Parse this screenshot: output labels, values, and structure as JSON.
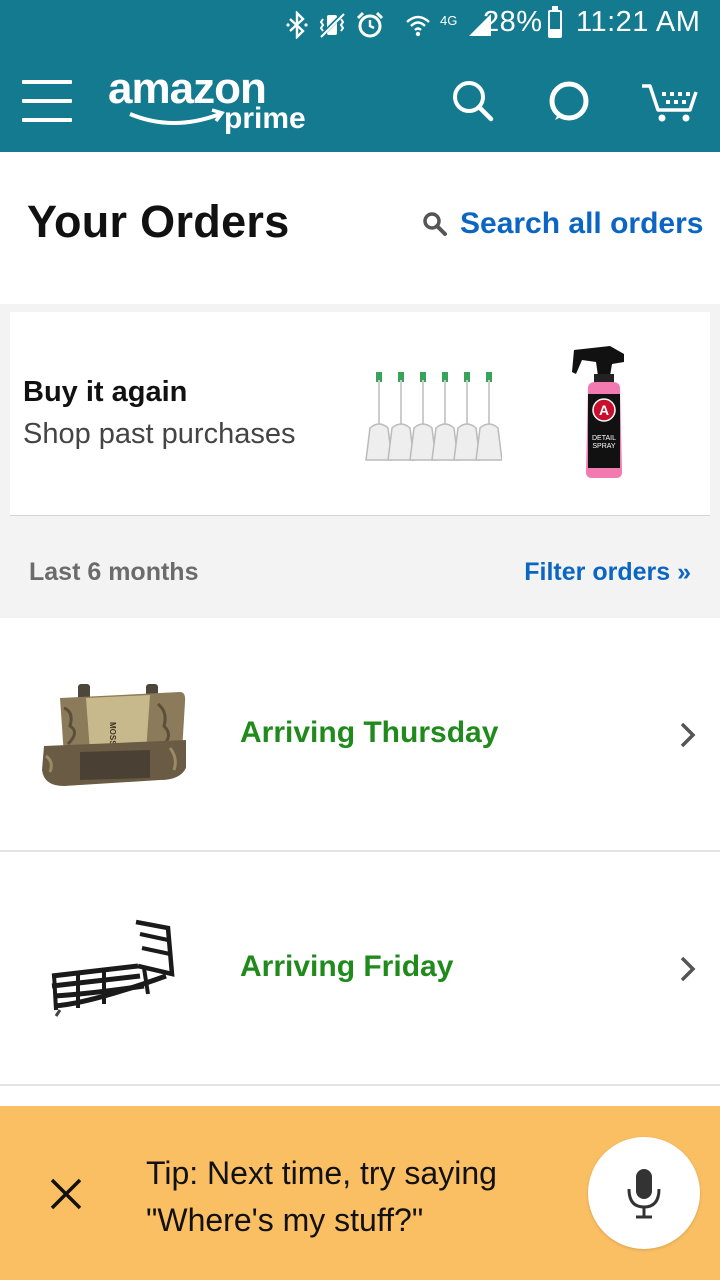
{
  "status_bar": {
    "battery_percent": "28%",
    "battery_level": 0.28,
    "time": "11:21 AM",
    "network": "4G",
    "icons": [
      "bluetooth-icon",
      "vibrate-icon",
      "alarm-icon",
      "wifi-icon",
      "signal-icon"
    ]
  },
  "app_bar": {
    "logo_word": "amazon",
    "logo_sub": "prime",
    "background": "#137a8f",
    "actions": [
      "search-icon",
      "alexa-icon",
      "cart-icon"
    ]
  },
  "orders": {
    "title": "Your Orders",
    "search_label": "Search all orders"
  },
  "buy_again": {
    "title": "Buy it again",
    "subtitle": "Shop past purchases",
    "product_icons": [
      "toothbrush-heads-image",
      "detail-spray-image"
    ],
    "spray_label_line1": "DETAIL",
    "spray_label_line2": "SPRAY",
    "spray_logo_letter": "A"
  },
  "filter": {
    "period": "Last 6 months",
    "link": "Filter orders »"
  },
  "order_list": [
    {
      "status": "Arriving Thursday",
      "image": "camo-seat-cover-image",
      "brand": "MOSSY OAK"
    },
    {
      "status": "Arriving Friday",
      "image": "truck-bed-extender-image"
    }
  ],
  "tip": {
    "line1": "Tip: Next time, try saying",
    "line2": "\"Where's my stuff?\"",
    "background": "#fbbf63"
  },
  "colors": {
    "link_blue": "#0a66c2",
    "arriving_green": "#208a1d",
    "teal": "#137a8f"
  }
}
